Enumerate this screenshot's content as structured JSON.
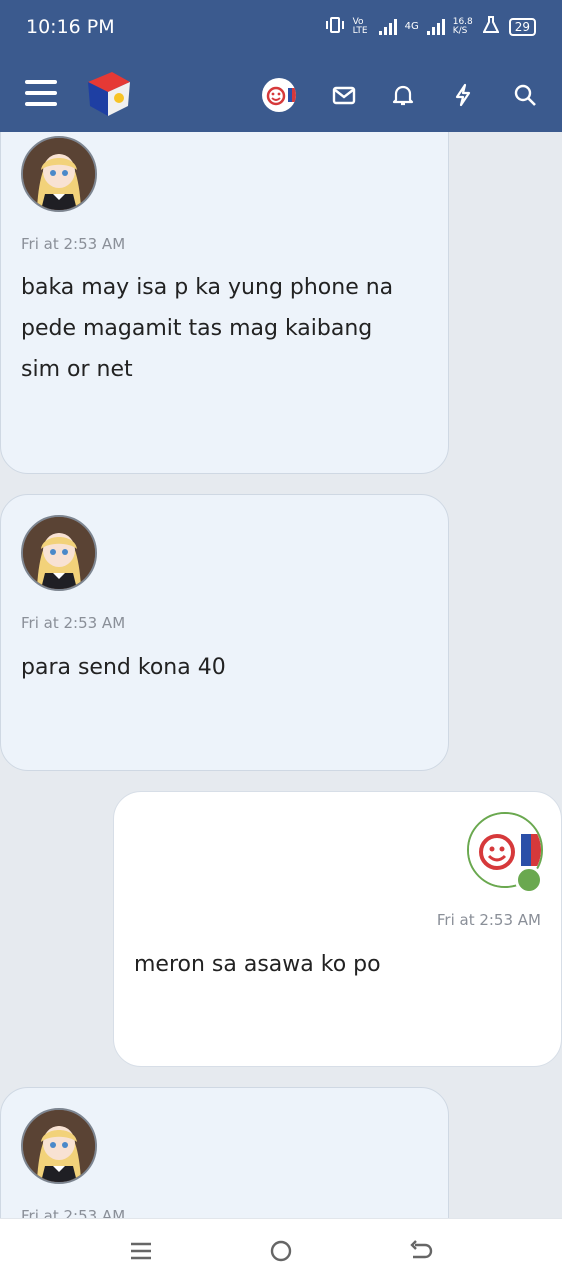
{
  "status_bar": {
    "time": "10:16 PM",
    "network1": "Vo LTE",
    "network2": "4G",
    "speed": "16.8 K/S",
    "battery": "29"
  },
  "app_bar": {
    "icons": [
      "menu-icon",
      "site-logo",
      "user-avatar",
      "mail-icon",
      "bell-icon",
      "lightning-icon",
      "search-icon"
    ]
  },
  "messages": [
    {
      "time": "Fri at 2:53 AM",
      "text_lines": [
        "baka may isa p ka yung phone na",
        "pede magamit tas mag kaibang",
        "sim or net"
      ]
    },
    {
      "time": "Fri at 2:53 AM",
      "text_lines": [
        "para send kona 40"
      ]
    },
    {
      "time": "Fri at 2:53 AM",
      "text_lines": [
        "meron sa asawa ko po"
      ]
    },
    {
      "time": "Fri at 2:53 AM",
      "text_lines": []
    }
  ],
  "colors": {
    "app_bar": "#3b5a8e",
    "bubble_other": "#edf3fa",
    "bubble_me": "#ffffff",
    "background": "#e6eaef",
    "online": "#6aa84f"
  }
}
